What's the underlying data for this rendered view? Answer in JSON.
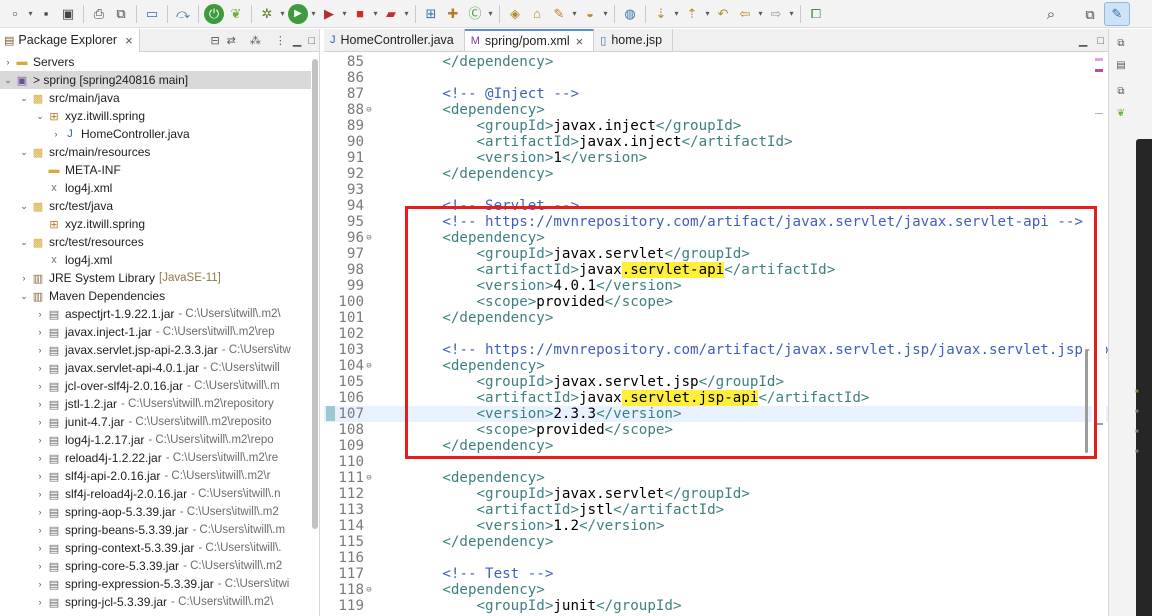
{
  "toolbar": {
    "icons": [
      "new-icon",
      "save-icon",
      "save-all-icon",
      "print-icon",
      "copy-icon",
      "terminal-icon",
      "debug-skip-icon",
      "spring-boot-icon",
      "spring-icon",
      "bug-icon",
      "run-icon",
      "coverage-icon",
      "stop-icon",
      "external-tools-icon",
      "new-java-project-icon",
      "new-package-icon",
      "new-class-icon",
      "open-type-icon",
      "open-task-icon",
      "search-icon",
      "globe-icon",
      "next-annotation-icon",
      "prev-annotation-icon",
      "last-edit-icon",
      "back-icon",
      "forward-icon",
      "pin-icon",
      "search-toolbar-icon",
      "open-perspective-icon",
      "java-perspective-icon"
    ]
  },
  "package_explorer": {
    "title": "Package Explorer",
    "rows": [
      {
        "label": "Servers",
        "icon": "folder-icon",
        "twist": "›",
        "indent": 0
      },
      {
        "label": "> spring [spring240816 main]",
        "icon": "project-icon",
        "twist": "⌄",
        "indent": 0,
        "selected": true
      },
      {
        "label": "src/main/java",
        "icon": "source-folder-icon",
        "twist": "⌄",
        "indent": 1
      },
      {
        "label": "xyz.itwill.spring",
        "icon": "package-icon",
        "twist": "⌄",
        "indent": 2
      },
      {
        "label": "HomeController.java",
        "icon": "java-file-icon",
        "twist": "›",
        "indent": 3
      },
      {
        "label": "src/main/resources",
        "icon": "source-folder-icon",
        "twist": "⌄",
        "indent": 1
      },
      {
        "label": "META-INF",
        "icon": "folder-icon",
        "twist": "",
        "indent": 2
      },
      {
        "label": "log4j.xml",
        "icon": "xml-file-icon",
        "twist": "",
        "indent": 2
      },
      {
        "label": "src/test/java",
        "icon": "source-folder-icon",
        "twist": "⌄",
        "indent": 1
      },
      {
        "label": "xyz.itwill.spring",
        "icon": "package-icon",
        "twist": "",
        "indent": 2
      },
      {
        "label": "src/test/resources",
        "icon": "source-folder-icon",
        "twist": "⌄",
        "indent": 1
      },
      {
        "label": "log4j.xml",
        "icon": "xml-file-icon",
        "twist": "",
        "indent": 2
      },
      {
        "label": "JRE System Library",
        "deco": "[JavaSE-11]",
        "icon": "library-icon",
        "twist": "›",
        "indent": 1
      },
      {
        "label": "Maven Dependencies",
        "icon": "library-icon",
        "twist": "⌄",
        "indent": 1
      },
      {
        "label": "aspectjrt-1.9.22.1.jar",
        "path": "- C:\\Users\\itwill\\.m2\\",
        "icon": "jar-icon",
        "twist": "›",
        "indent": 2
      },
      {
        "label": "javax.inject-1.jar",
        "path": "- C:\\Users\\itwill\\.m2\\rep",
        "icon": "jar-icon",
        "twist": "›",
        "indent": 2
      },
      {
        "label": "javax.servlet.jsp-api-2.3.3.jar",
        "path": "- C:\\Users\\itw",
        "icon": "jar-icon",
        "twist": "›",
        "indent": 2
      },
      {
        "label": "javax.servlet-api-4.0.1.jar",
        "path": "- C:\\Users\\itwill",
        "icon": "jar-icon",
        "twist": "›",
        "indent": 2
      },
      {
        "label": "jcl-over-slf4j-2.0.16.jar",
        "path": "- C:\\Users\\itwill\\.m",
        "icon": "jar-icon",
        "twist": "›",
        "indent": 2
      },
      {
        "label": "jstl-1.2.jar",
        "path": "- C:\\Users\\itwill\\.m2\\repository",
        "icon": "jar-icon",
        "twist": "›",
        "indent": 2
      },
      {
        "label": "junit-4.7.jar",
        "path": "- C:\\Users\\itwill\\.m2\\reposito",
        "icon": "jar-icon",
        "twist": "›",
        "indent": 2
      },
      {
        "label": "log4j-1.2.17.jar",
        "path": "- C:\\Users\\itwill\\.m2\\repo",
        "icon": "jar-icon",
        "twist": "›",
        "indent": 2
      },
      {
        "label": "reload4j-1.2.22.jar",
        "path": "- C:\\Users\\itwill\\.m2\\re",
        "icon": "jar-icon",
        "twist": "›",
        "indent": 2
      },
      {
        "label": "slf4j-api-2.0.16.jar",
        "path": "- C:\\Users\\itwill\\.m2\\r",
        "icon": "jar-icon",
        "twist": "›",
        "indent": 2
      },
      {
        "label": "slf4j-reload4j-2.0.16.jar",
        "path": "- C:\\Users\\itwill\\.n",
        "icon": "jar-icon",
        "twist": "›",
        "indent": 2
      },
      {
        "label": "spring-aop-5.3.39.jar",
        "path": "- C:\\Users\\itwill\\.m2",
        "icon": "jar-icon",
        "twist": "›",
        "indent": 2
      },
      {
        "label": "spring-beans-5.3.39.jar",
        "path": "- C:\\Users\\itwill\\.m",
        "icon": "jar-icon",
        "twist": "›",
        "indent": 2
      },
      {
        "label": "spring-context-5.3.39.jar",
        "path": "- C:\\Users\\itwill\\.",
        "icon": "jar-icon",
        "twist": "›",
        "indent": 2
      },
      {
        "label": "spring-core-5.3.39.jar",
        "path": "- C:\\Users\\itwill\\.m2",
        "icon": "jar-icon",
        "twist": "›",
        "indent": 2
      },
      {
        "label": "spring-expression-5.3.39.jar",
        "path": "- C:\\Users\\itwi",
        "icon": "jar-icon",
        "twist": "›",
        "indent": 2
      },
      {
        "label": "spring-jcl-5.3.39.jar",
        "path": "- C:\\Users\\itwill\\.m2\\",
        "icon": "jar-icon",
        "twist": "›",
        "indent": 2
      }
    ]
  },
  "editor": {
    "tabs": [
      {
        "label": "HomeController.java",
        "icon": "java-file-icon",
        "active": false
      },
      {
        "label": "spring/pom.xml",
        "icon": "maven-pom-icon",
        "active": true
      },
      {
        "label": "home.jsp",
        "icon": "jsp-file-icon",
        "active": false
      }
    ],
    "lines": [
      {
        "n": "85",
        "fold": "",
        "segs": [
          [
            "tag",
            "        </dependency>"
          ]
        ]
      },
      {
        "n": "86",
        "fold": "",
        "segs": []
      },
      {
        "n": "87",
        "fold": "",
        "segs": [
          [
            "comment",
            "        <!-- @Inject -->"
          ]
        ]
      },
      {
        "n": "88",
        "fold": "⊖",
        "segs": [
          [
            "tag",
            "        <dependency>"
          ]
        ]
      },
      {
        "n": "89",
        "fold": "",
        "segs": [
          [
            "tag",
            "            <groupId>"
          ],
          [
            "text",
            "javax.inject"
          ],
          [
            "tag",
            "</groupId>"
          ]
        ]
      },
      {
        "n": "90",
        "fold": "",
        "segs": [
          [
            "tag",
            "            <artifactId>"
          ],
          [
            "text",
            "javax.inject"
          ],
          [
            "tag",
            "</artifactId>"
          ]
        ]
      },
      {
        "n": "91",
        "fold": "",
        "segs": [
          [
            "tag",
            "            <version>"
          ],
          [
            "text",
            "1"
          ],
          [
            "tag",
            "</version>"
          ]
        ]
      },
      {
        "n": "92",
        "fold": "",
        "segs": [
          [
            "tag",
            "        </dependency>"
          ]
        ]
      },
      {
        "n": "93",
        "fold": "",
        "segs": []
      },
      {
        "n": "94",
        "fold": "",
        "segs": [
          [
            "comment",
            "        <!-- Servlet -->"
          ]
        ]
      },
      {
        "n": "95",
        "fold": "",
        "segs": [
          [
            "comment",
            "        <!-- https://mvnrepository.com/artifact/javax.servlet/javax.servlet-api -->"
          ]
        ]
      },
      {
        "n": "96",
        "fold": "⊖",
        "segs": [
          [
            "tag",
            "        <dependency>"
          ]
        ]
      },
      {
        "n": "97",
        "fold": "",
        "segs": [
          [
            "tag",
            "            <groupId>"
          ],
          [
            "text",
            "javax.servlet"
          ],
          [
            "tag",
            "</groupId>"
          ]
        ]
      },
      {
        "n": "98",
        "fold": "",
        "segs": [
          [
            "tag",
            "            <artifactId>"
          ],
          [
            "text",
            "javax"
          ],
          [
            "hl",
            ".servlet-api"
          ],
          [
            "tag",
            "</artifactId>"
          ]
        ]
      },
      {
        "n": "99",
        "fold": "",
        "segs": [
          [
            "tag",
            "            <version>"
          ],
          [
            "text",
            "4.0.1"
          ],
          [
            "tag",
            "</version>"
          ]
        ]
      },
      {
        "n": "100",
        "fold": "",
        "segs": [
          [
            "tag",
            "            <scope>"
          ],
          [
            "text",
            "provided"
          ],
          [
            "tag",
            "</scope>"
          ]
        ]
      },
      {
        "n": "101",
        "fold": "",
        "segs": [
          [
            "tag",
            "        </dependency>"
          ]
        ]
      },
      {
        "n": "102",
        "fold": "",
        "segs": []
      },
      {
        "n": "103",
        "fold": "",
        "segs": [
          [
            "comment",
            "        <!-- https://mvnrepository.com/artifact/javax.servlet.jsp/javax.servlet.jsp-api"
          ]
        ]
      },
      {
        "n": "104",
        "fold": "⊖",
        "segs": [
          [
            "tag",
            "        <dependency>"
          ]
        ]
      },
      {
        "n": "105",
        "fold": "",
        "segs": [
          [
            "tag",
            "            <groupId>"
          ],
          [
            "text",
            "javax.servlet.jsp"
          ],
          [
            "tag",
            "</groupId>"
          ]
        ]
      },
      {
        "n": "106",
        "fold": "",
        "segs": [
          [
            "tag",
            "            <artifactId>"
          ],
          [
            "text",
            "javax"
          ],
          [
            "hl",
            ".servlet.jsp-api"
          ],
          [
            "tag",
            "</artifactId>"
          ]
        ]
      },
      {
        "n": "107",
        "fold": "",
        "current": true,
        "changed": true,
        "segs": [
          [
            "tag",
            "            <version>"
          ],
          [
            "text",
            "2.3.3"
          ],
          [
            "tag",
            "</version>"
          ]
        ]
      },
      {
        "n": "108",
        "fold": "",
        "segs": [
          [
            "tag",
            "            <scope>"
          ],
          [
            "text",
            "provided"
          ],
          [
            "tag",
            "</scope>"
          ]
        ]
      },
      {
        "n": "109",
        "fold": "",
        "segs": [
          [
            "tag",
            "        </dependency>"
          ]
        ]
      },
      {
        "n": "110",
        "fold": "",
        "segs": []
      },
      {
        "n": "111",
        "fold": "⊖",
        "segs": [
          [
            "tag",
            "        <dependency>"
          ]
        ]
      },
      {
        "n": "112",
        "fold": "",
        "segs": [
          [
            "tag",
            "            <groupId>"
          ],
          [
            "text",
            "javax.servlet"
          ],
          [
            "tag",
            "</groupId>"
          ]
        ]
      },
      {
        "n": "113",
        "fold": "",
        "segs": [
          [
            "tag",
            "            <artifactId>"
          ],
          [
            "text",
            "jstl"
          ],
          [
            "tag",
            "</artifactId>"
          ]
        ]
      },
      {
        "n": "114",
        "fold": "",
        "segs": [
          [
            "tag",
            "            <version>"
          ],
          [
            "text",
            "1.2"
          ],
          [
            "tag",
            "</version>"
          ]
        ]
      },
      {
        "n": "115",
        "fold": "",
        "segs": [
          [
            "tag",
            "        </dependency>"
          ]
        ]
      },
      {
        "n": "116",
        "fold": "",
        "segs": []
      },
      {
        "n": "117",
        "fold": "",
        "segs": [
          [
            "comment",
            "        <!-- Test -->"
          ]
        ]
      },
      {
        "n": "118",
        "fold": "⊖",
        "segs": [
          [
            "tag",
            "        <dependency>"
          ]
        ]
      },
      {
        "n": "119",
        "fold": "",
        "segs": [
          [
            "tag",
            "            <groupId>"
          ],
          [
            "text",
            "junit"
          ],
          [
            "tag",
            "</groupId>"
          ]
        ]
      }
    ]
  },
  "colors": {
    "comment": "#3f5fbf",
    "tag": "#3f7f7f",
    "highlight": "#ffef3a",
    "annotation_box": "#e51d1d",
    "current_line": "#e8f2fe"
  }
}
